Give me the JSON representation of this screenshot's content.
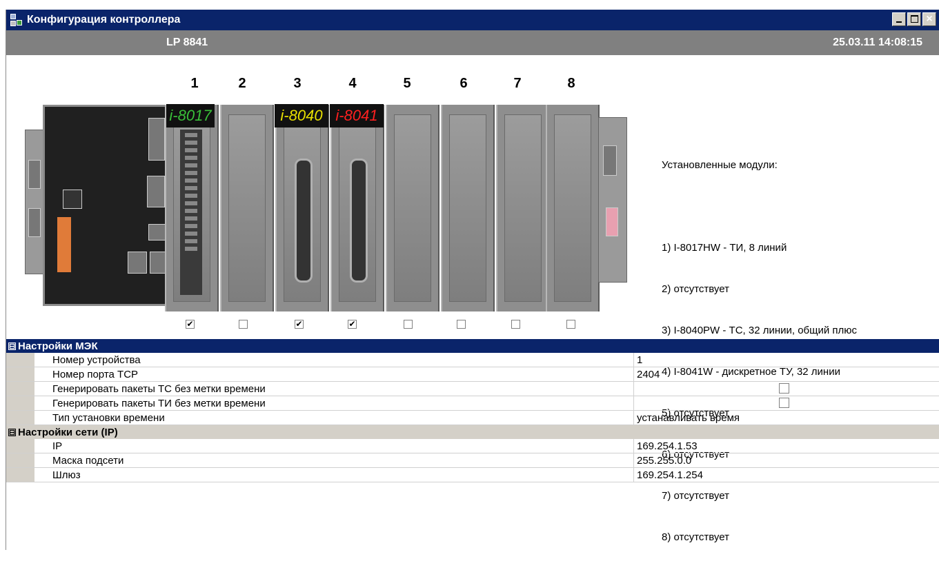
{
  "window": {
    "title": "Конфигурация контроллера",
    "min_icon": "minimize-icon",
    "max_icon": "maximize-icon",
    "close_icon": "close-icon",
    "close_label": "×"
  },
  "info": {
    "model": "LP 8841",
    "datetime": "25.03.11 14:08:15"
  },
  "rack": {
    "slot_numbers": [
      "1",
      "2",
      "3",
      "4",
      "5",
      "6",
      "7",
      "8"
    ],
    "module_labels": {
      "slot1": "i-8017",
      "slot3": "i-8040",
      "slot4": "i-8041"
    },
    "label_colors": {
      "slot1": "#39c039",
      "slot3": "#e8e000",
      "slot4": "#ff2020"
    },
    "checkboxes": [
      true,
      false,
      true,
      true,
      false,
      false,
      false,
      false
    ],
    "check_mark": "✔"
  },
  "modules_list": {
    "heading": "Установленные модули:",
    "items": [
      "1) I-8017HW - ТИ, 8 линий",
      "2) отсутствует",
      "3) I-8040PW - ТС, 32 линии, общий плюс",
      "4) I-8041W - дискретное ТУ, 32 линии",
      "5) отсутствует",
      "6) отсутствует",
      "7) отсутствует",
      "8) отсутствует"
    ]
  },
  "grid": {
    "collapse_glyph": "⊟",
    "iec": {
      "title": "Настройки МЭК",
      "rows": [
        {
          "name": "Номер устройства",
          "value": "1"
        },
        {
          "name": "Номер порта TCP",
          "value": "2404"
        },
        {
          "name": "Генерировать пакеты ТС без метки времени",
          "value": "",
          "checkbox": true
        },
        {
          "name": "Генерировать пакеты ТИ без метки времени",
          "value": "",
          "checkbox": true
        },
        {
          "name": "Тип установки времени",
          "value": "устанавливать время"
        }
      ]
    },
    "net": {
      "title": "Настройки сети (IP)",
      "rows": [
        {
          "name": "IP",
          "value": "169.254.1.53"
        },
        {
          "name": "Маска подсети",
          "value": "255.255.0.0"
        },
        {
          "name": "Шлюз",
          "value": "169.254.1.254"
        }
      ]
    }
  }
}
